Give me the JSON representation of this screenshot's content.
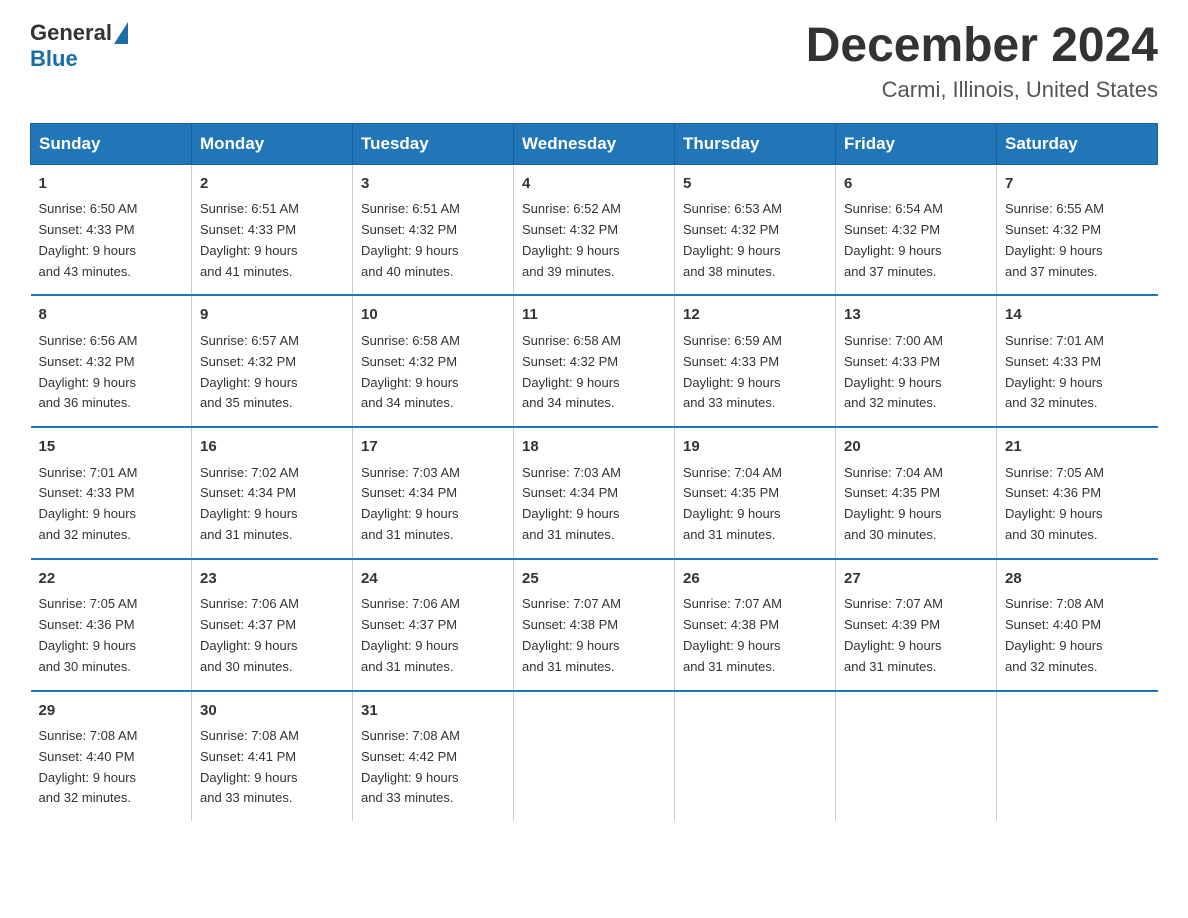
{
  "logo": {
    "general": "General",
    "blue": "Blue"
  },
  "title": {
    "month_year": "December 2024",
    "location": "Carmi, Illinois, United States"
  },
  "days_of_week": [
    "Sunday",
    "Monday",
    "Tuesday",
    "Wednesday",
    "Thursday",
    "Friday",
    "Saturday"
  ],
  "weeks": [
    [
      {
        "day": "1",
        "sunrise": "6:50 AM",
        "sunset": "4:33 PM",
        "daylight": "9 hours and 43 minutes."
      },
      {
        "day": "2",
        "sunrise": "6:51 AM",
        "sunset": "4:33 PM",
        "daylight": "9 hours and 41 minutes."
      },
      {
        "day": "3",
        "sunrise": "6:51 AM",
        "sunset": "4:32 PM",
        "daylight": "9 hours and 40 minutes."
      },
      {
        "day": "4",
        "sunrise": "6:52 AM",
        "sunset": "4:32 PM",
        "daylight": "9 hours and 39 minutes."
      },
      {
        "day": "5",
        "sunrise": "6:53 AM",
        "sunset": "4:32 PM",
        "daylight": "9 hours and 38 minutes."
      },
      {
        "day": "6",
        "sunrise": "6:54 AM",
        "sunset": "4:32 PM",
        "daylight": "9 hours and 37 minutes."
      },
      {
        "day": "7",
        "sunrise": "6:55 AM",
        "sunset": "4:32 PM",
        "daylight": "9 hours and 37 minutes."
      }
    ],
    [
      {
        "day": "8",
        "sunrise": "6:56 AM",
        "sunset": "4:32 PM",
        "daylight": "9 hours and 36 minutes."
      },
      {
        "day": "9",
        "sunrise": "6:57 AM",
        "sunset": "4:32 PM",
        "daylight": "9 hours and 35 minutes."
      },
      {
        "day": "10",
        "sunrise": "6:58 AM",
        "sunset": "4:32 PM",
        "daylight": "9 hours and 34 minutes."
      },
      {
        "day": "11",
        "sunrise": "6:58 AM",
        "sunset": "4:32 PM",
        "daylight": "9 hours and 34 minutes."
      },
      {
        "day": "12",
        "sunrise": "6:59 AM",
        "sunset": "4:33 PM",
        "daylight": "9 hours and 33 minutes."
      },
      {
        "day": "13",
        "sunrise": "7:00 AM",
        "sunset": "4:33 PM",
        "daylight": "9 hours and 32 minutes."
      },
      {
        "day": "14",
        "sunrise": "7:01 AM",
        "sunset": "4:33 PM",
        "daylight": "9 hours and 32 minutes."
      }
    ],
    [
      {
        "day": "15",
        "sunrise": "7:01 AM",
        "sunset": "4:33 PM",
        "daylight": "9 hours and 32 minutes."
      },
      {
        "day": "16",
        "sunrise": "7:02 AM",
        "sunset": "4:34 PM",
        "daylight": "9 hours and 31 minutes."
      },
      {
        "day": "17",
        "sunrise": "7:03 AM",
        "sunset": "4:34 PM",
        "daylight": "9 hours and 31 minutes."
      },
      {
        "day": "18",
        "sunrise": "7:03 AM",
        "sunset": "4:34 PM",
        "daylight": "9 hours and 31 minutes."
      },
      {
        "day": "19",
        "sunrise": "7:04 AM",
        "sunset": "4:35 PM",
        "daylight": "9 hours and 31 minutes."
      },
      {
        "day": "20",
        "sunrise": "7:04 AM",
        "sunset": "4:35 PM",
        "daylight": "9 hours and 30 minutes."
      },
      {
        "day": "21",
        "sunrise": "7:05 AM",
        "sunset": "4:36 PM",
        "daylight": "9 hours and 30 minutes."
      }
    ],
    [
      {
        "day": "22",
        "sunrise": "7:05 AM",
        "sunset": "4:36 PM",
        "daylight": "9 hours and 30 minutes."
      },
      {
        "day": "23",
        "sunrise": "7:06 AM",
        "sunset": "4:37 PM",
        "daylight": "9 hours and 30 minutes."
      },
      {
        "day": "24",
        "sunrise": "7:06 AM",
        "sunset": "4:37 PM",
        "daylight": "9 hours and 31 minutes."
      },
      {
        "day": "25",
        "sunrise": "7:07 AM",
        "sunset": "4:38 PM",
        "daylight": "9 hours and 31 minutes."
      },
      {
        "day": "26",
        "sunrise": "7:07 AM",
        "sunset": "4:38 PM",
        "daylight": "9 hours and 31 minutes."
      },
      {
        "day": "27",
        "sunrise": "7:07 AM",
        "sunset": "4:39 PM",
        "daylight": "9 hours and 31 minutes."
      },
      {
        "day": "28",
        "sunrise": "7:08 AM",
        "sunset": "4:40 PM",
        "daylight": "9 hours and 32 minutes."
      }
    ],
    [
      {
        "day": "29",
        "sunrise": "7:08 AM",
        "sunset": "4:40 PM",
        "daylight": "9 hours and 32 minutes."
      },
      {
        "day": "30",
        "sunrise": "7:08 AM",
        "sunset": "4:41 PM",
        "daylight": "9 hours and 33 minutes."
      },
      {
        "day": "31",
        "sunrise": "7:08 AM",
        "sunset": "4:42 PM",
        "daylight": "9 hours and 33 minutes."
      },
      null,
      null,
      null,
      null
    ]
  ],
  "labels": {
    "sunrise": "Sunrise: ",
    "sunset": "Sunset: ",
    "daylight": "Daylight: "
  }
}
